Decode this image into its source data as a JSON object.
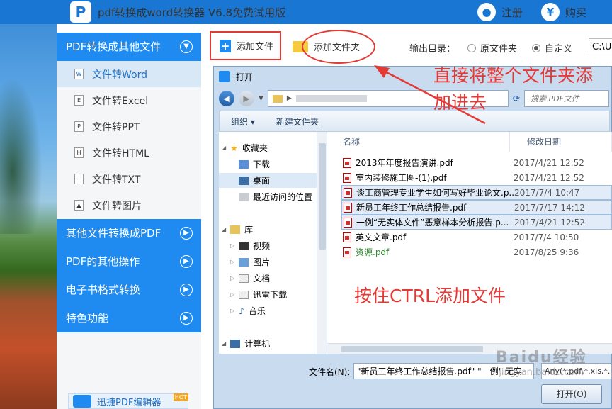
{
  "app": {
    "logo_letter": "P",
    "title": "pdf转换成word转换器 V6.8免费试用版",
    "register_label": "注册",
    "buy_label": "购买",
    "register_icon": "user-icon",
    "buy_icon": "yen-icon",
    "buy_icon_glyph": "¥"
  },
  "sidebar": {
    "categories": [
      {
        "label": "PDF转换成其他文件",
        "expanded": true
      },
      {
        "label": "其他文件转换成PDF",
        "expanded": false
      },
      {
        "label": "PDF的其他操作",
        "expanded": false
      },
      {
        "label": "电子书格式转换",
        "expanded": false
      },
      {
        "label": "特色功能",
        "expanded": false
      }
    ],
    "items": [
      {
        "label": "文件转Word",
        "icon_letter": "W",
        "active": true
      },
      {
        "label": "文件转Excel",
        "icon_letter": "E"
      },
      {
        "label": "文件转PPT",
        "icon_letter": "P"
      },
      {
        "label": "文件转HTML",
        "icon_letter": "H"
      },
      {
        "label": "文件转TXT",
        "icon_letter": "T"
      },
      {
        "label": "文件转图片",
        "icon_letter": "▲"
      }
    ],
    "promo_label": "迅捷PDF编辑器",
    "promo_badge": "HOT"
  },
  "toolbar": {
    "add_file_label": "添加文件",
    "add_folder_label": "添加文件夹",
    "output_label": "输出目录：",
    "option_source": "原文件夹",
    "option_custom": "自定义",
    "selected_option": "自定义",
    "path_value": "C:\\Us"
  },
  "dialog": {
    "title": "打开",
    "search_placeholder": "搜索 PDF文件",
    "organize_label": "组织 ▾",
    "new_folder_label": "新建文件夹",
    "nav": {
      "favorites": "收藏夹",
      "downloads": "下载",
      "desktop": "桌面",
      "recent": "最近访问的位置",
      "library": "库",
      "videos": "视频",
      "pictures": "图片",
      "documents": "文档",
      "thunder": "迅雷下载",
      "music": "音乐",
      "computer": "计算机"
    },
    "columns": {
      "name": "名称",
      "modified": "修改日期"
    },
    "files": [
      {
        "name": "2013年年度报告演讲.pdf",
        "date": "2017/4/21 12:52",
        "selected": false
      },
      {
        "name": "室内装修施工图-(1).pdf",
        "date": "2017/4/21 12:52",
        "selected": false
      },
      {
        "name": "谈工商管理专业学生如何写好毕业论文.p...",
        "date": "2017/7/4 10:47",
        "selected": true
      },
      {
        "name": "新员工年终工作总结报告.pdf",
        "date": "2017/7/17 14:12",
        "selected": true
      },
      {
        "name": "一例“无实体文件”恶意样本分析报告.p...",
        "date": "2017/4/21 12:52",
        "selected": true
      },
      {
        "name": "英文文章.pdf",
        "date": "2017/7/4 10:50",
        "selected": false
      },
      {
        "name": "资源.pdf",
        "date": "2017/8/25 9:36",
        "selected": false
      }
    ],
    "filename_label": "文件名(N):",
    "filename_value": "\"新员工年终工作总结报告.pdf\" \"一例\" 无实",
    "filetype_value": "Any(*.pdf,*.xls,*.x",
    "open_label": "打开(O)"
  },
  "annotations": {
    "folder_note": "直接将整个文件夹添加进去",
    "ctrl_note": "按住CTRL添加文件",
    "color": "#e53935"
  },
  "watermark": {
    "line1": "Baidu经验",
    "line2": "jingyan.baidu.com"
  }
}
